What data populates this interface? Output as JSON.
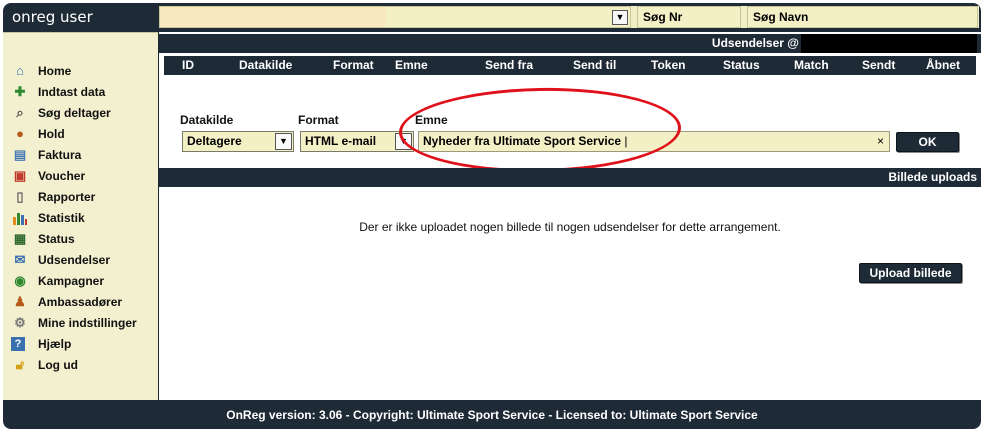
{
  "brand": "onreg user",
  "topbar": {
    "search_nr": "Søg Nr",
    "search_name": "Søg Navn"
  },
  "sidebar": {
    "items": [
      {
        "label": "Home",
        "icon": "home-icon"
      },
      {
        "label": "Indtast data",
        "icon": "add-user-icon"
      },
      {
        "label": "Søg deltager",
        "icon": "search-user-icon"
      },
      {
        "label": "Hold",
        "icon": "team-icon"
      },
      {
        "label": "Faktura",
        "icon": "invoice-icon"
      },
      {
        "label": "Voucher",
        "icon": "gift-icon"
      },
      {
        "label": "Rapporter",
        "icon": "report-icon"
      },
      {
        "label": "Statistik",
        "icon": "chart-icon"
      },
      {
        "label": "Status",
        "icon": "status-icon"
      },
      {
        "label": "Udsendelser",
        "icon": "mail-icon"
      },
      {
        "label": "Kampagner",
        "icon": "campaign-icon"
      },
      {
        "label": "Ambassadører",
        "icon": "ambassador-icon"
      },
      {
        "label": "Mine indstillinger",
        "icon": "gear-icon"
      },
      {
        "label": "Hjælp",
        "icon": "help-icon"
      },
      {
        "label": "Log ud",
        "icon": "lock-icon"
      }
    ]
  },
  "udsendelser": {
    "title": "Udsendelser @",
    "columns": [
      "ID",
      "Datakilde",
      "Format",
      "Emne",
      "Send fra",
      "Send til",
      "Token",
      "Status",
      "Match",
      "Sendt",
      "Åbnet"
    ]
  },
  "form": {
    "datakilde_label": "Datakilde",
    "datakilde_value": "Deltagere",
    "format_label": "Format",
    "format_value": "HTML e-mail",
    "emne_label": "Emne",
    "emne_value": "Nyheder fra Ultimate Sport Service",
    "clear": "×",
    "ok_label": "OK"
  },
  "uploads": {
    "title": "Billede uploads",
    "message": "Der er ikke uploadet nogen billede til nogen udsendelser for dette arrangement.",
    "upload_button": "Upload billede"
  },
  "footer": "OnReg version: 3.06 - Copyright: Ultimate Sport Service - Licensed to: Ultimate Sport Service",
  "colors": {
    "dark": "#1e2a36",
    "panel": "#f2f0cf",
    "highlight": "#e0111a"
  }
}
